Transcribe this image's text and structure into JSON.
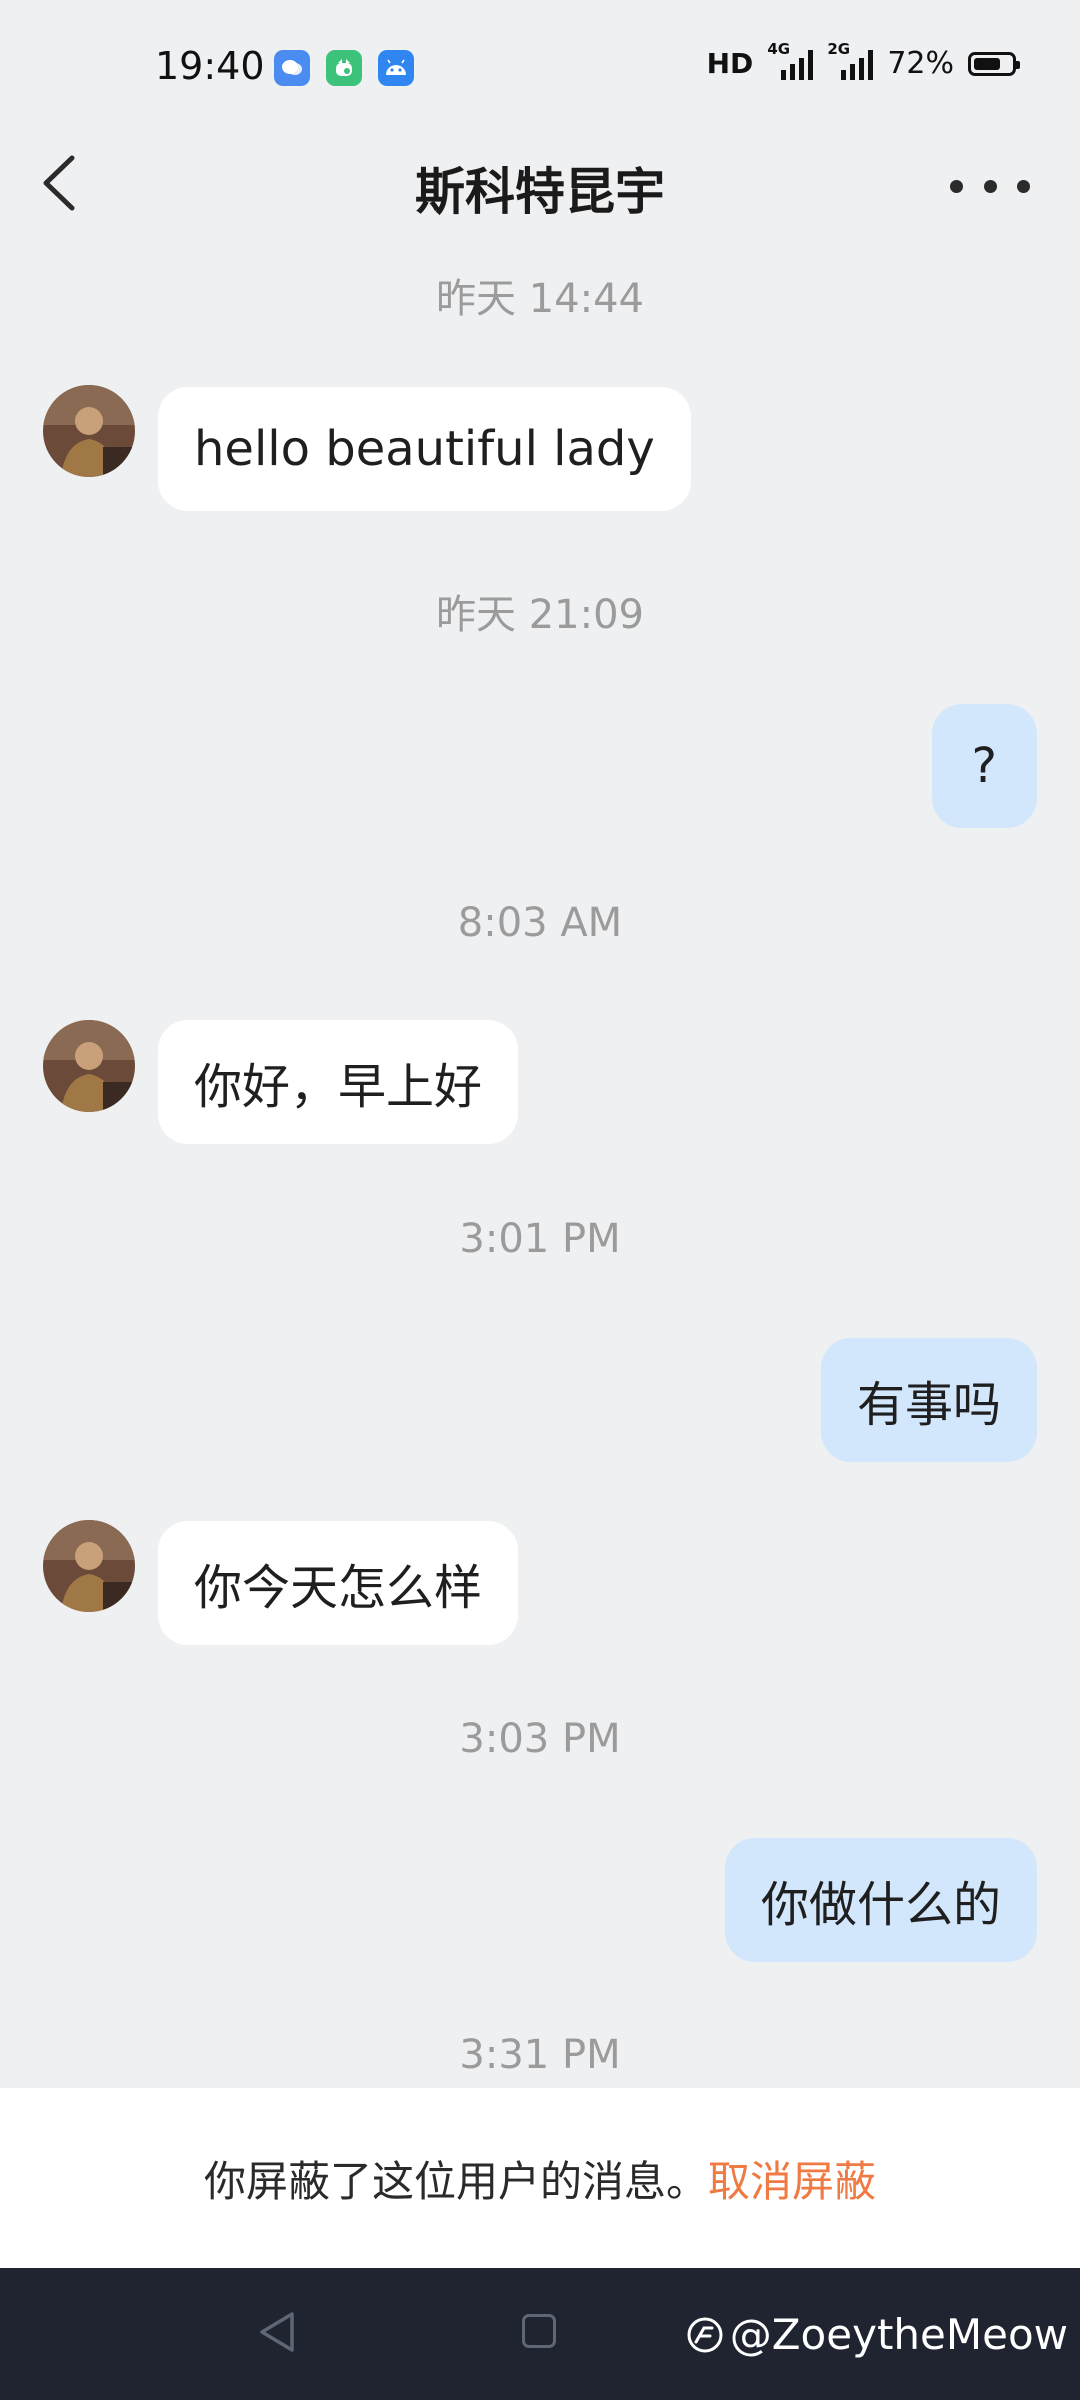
{
  "status_bar": {
    "time": "19:40",
    "app_icons": [
      "chat-bubble-icon",
      "green-app-icon",
      "android-icon"
    ],
    "hd_label": "HD",
    "network_1": "4G",
    "network_2": "2G",
    "battery_percent_label": "72%",
    "battery_level": 0.72
  },
  "header": {
    "title": "斯科特昆宇",
    "back_icon": "chevron-left-icon",
    "more_icon": "more-dots-icon"
  },
  "messages": [
    {
      "type": "timestamp",
      "text": "昨天 14:44"
    },
    {
      "type": "incoming",
      "text": "hello beautiful lady"
    },
    {
      "type": "timestamp",
      "text": "昨天 21:09"
    },
    {
      "type": "outgoing",
      "text": "?"
    },
    {
      "type": "timestamp",
      "text": "8:03 AM"
    },
    {
      "type": "incoming",
      "text": "你好，早上好"
    },
    {
      "type": "timestamp",
      "text": "3:01 PM"
    },
    {
      "type": "outgoing",
      "text": "有事吗"
    },
    {
      "type": "incoming",
      "text": "你今天怎么样"
    },
    {
      "type": "timestamp",
      "text": "3:03 PM"
    },
    {
      "type": "outgoing",
      "text": "你做什么的"
    },
    {
      "type": "timestamp",
      "text": "3:31 PM"
    }
  ],
  "block_notice": {
    "text": "你屏蔽了这位用户的消息。",
    "action": "取消屏蔽"
  },
  "nav_bar": {
    "watermark": "@ZoeytheMeow"
  },
  "colors": {
    "background": "#eff0f2",
    "incoming_bubble": "#ffffff",
    "outgoing_bubble": "#d2e6fc",
    "unblock_link": "#f07a43",
    "nav_bar": "#1f2430"
  }
}
